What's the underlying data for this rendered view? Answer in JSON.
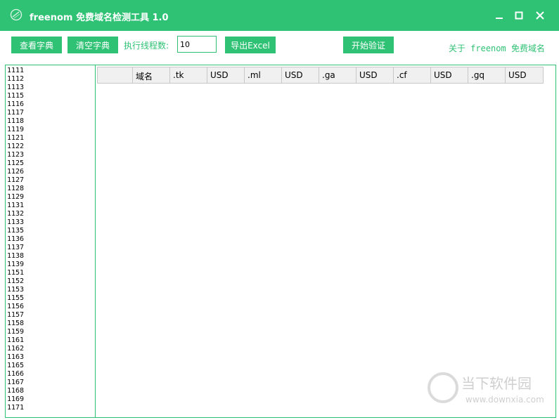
{
  "window": {
    "title": "freenom 免费域名检测工具 1.0",
    "accent_color": "#2fc274",
    "controls": [
      "minimize-icon",
      "maximize-icon",
      "close-icon"
    ]
  },
  "toolbar": {
    "view_dict_label": "查看字典",
    "clear_dict_label": "清空字典",
    "thread_label": "执行线程数:",
    "thread_value": "10",
    "export_label": "导出Excel",
    "start_label": "开始验证",
    "about_prefix": "关于 freenom",
    "about_suffix": "免费域名"
  },
  "dictionary": {
    "lines": [
      "1111",
      "1112",
      "1113",
      "1115",
      "1116",
      "1117",
      "1118",
      "1119",
      "1121",
      "1122",
      "1123",
      "1125",
      "1126",
      "1127",
      "1128",
      "1129",
      "1131",
      "1132",
      "1133",
      "1135",
      "1136",
      "1137",
      "1138",
      "1139",
      "1151",
      "1152",
      "1153",
      "1155",
      "1156",
      "1157",
      "1158",
      "1159",
      "1161",
      "1162",
      "1163",
      "1165",
      "1166",
      "1167",
      "1168",
      "1169",
      "1171"
    ]
  },
  "results_table": {
    "columns": [
      "域名",
      ".tk",
      "USD",
      ".ml",
      "USD",
      ".ga",
      "USD",
      ".cf",
      "USD",
      ".gq",
      "USD"
    ],
    "rows": []
  },
  "watermark": {
    "title": "当下软件园",
    "url": "www.downxia.com"
  }
}
